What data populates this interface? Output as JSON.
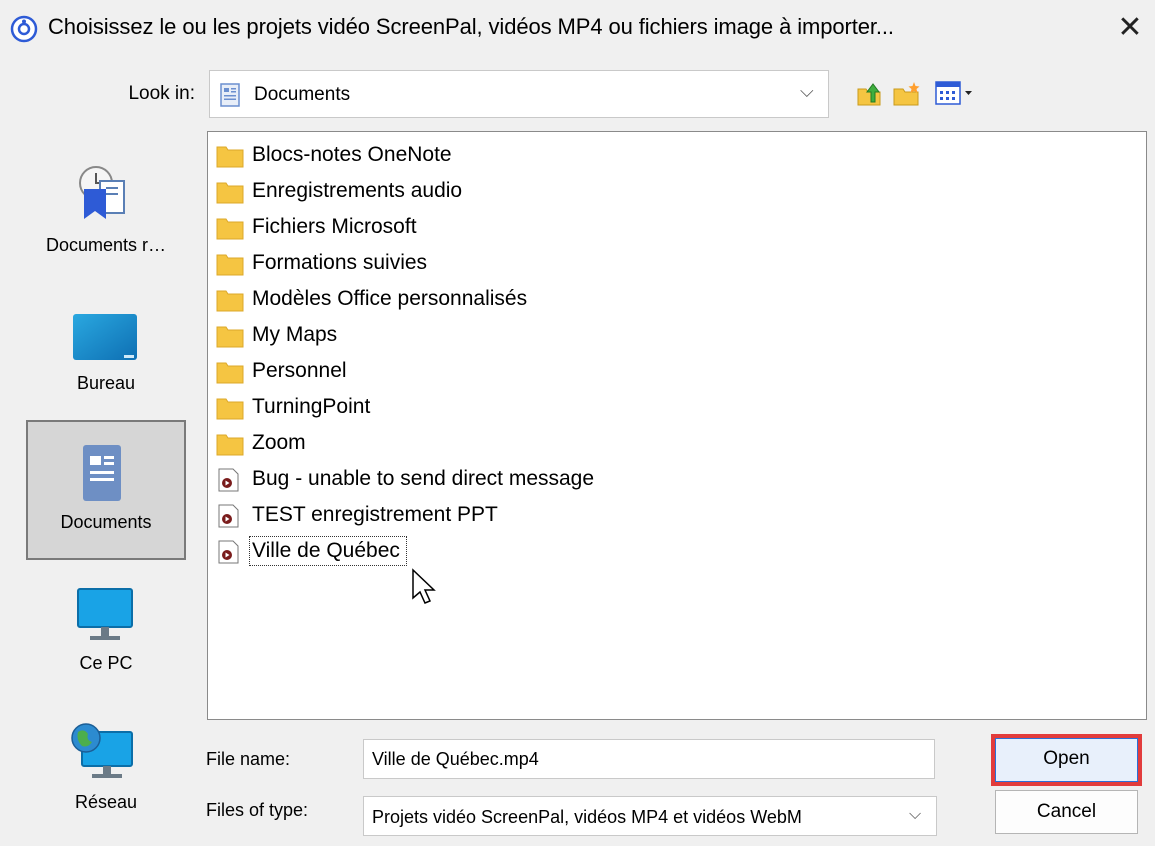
{
  "window": {
    "title": "Choisissez le ou les projets vidéo ScreenPal, vidéos MP4 ou fichiers image à importer...",
    "close_glyph": "✕",
    "app_icon": "screenpal-logo-icon"
  },
  "lookin": {
    "label": "Look in:",
    "value": "Documents",
    "icon": "documents-icon",
    "chevron": "⌵"
  },
  "toolbar": {
    "icons": [
      "up-folder-icon",
      "new-folder-icon",
      "view-menu-icon"
    ]
  },
  "places": [
    {
      "label": "Documents r…",
      "icon": "recent-places-icon",
      "selected": false
    },
    {
      "label": "Bureau",
      "icon": "desktop-icon",
      "selected": false
    },
    {
      "label": "Documents",
      "icon": "documents-icon",
      "selected": true
    },
    {
      "label": "Ce PC",
      "icon": "computer-icon",
      "selected": false
    },
    {
      "label": "Réseau",
      "icon": "network-icon",
      "selected": false
    }
  ],
  "files": [
    {
      "name": "Blocs-notes OneNote",
      "type": "folder"
    },
    {
      "name": "Enregistrements audio",
      "type": "folder"
    },
    {
      "name": "Fichiers Microsoft",
      "type": "folder"
    },
    {
      "name": "Formations suivies",
      "type": "folder"
    },
    {
      "name": "Modèles Office personnalisés",
      "type": "folder"
    },
    {
      "name": "My Maps",
      "type": "folder"
    },
    {
      "name": "Personnel",
      "type": "folder"
    },
    {
      "name": "TurningPoint",
      "type": "folder"
    },
    {
      "name": "Zoom",
      "type": "folder"
    },
    {
      "name": "Bug - unable to send direct message",
      "type": "video"
    },
    {
      "name": "TEST enregistrement PPT",
      "type": "video"
    },
    {
      "name": "Ville de Québec",
      "type": "video",
      "focused": true
    }
  ],
  "filename": {
    "label": "File name:",
    "value": "Ville de Québec.mp4"
  },
  "filetype": {
    "label": "Files of type:",
    "value": "Projets vidéo ScreenPal, vidéos MP4 et vidéos WebM",
    "chevron": "⌵"
  },
  "buttons": {
    "open": "Open",
    "cancel": "Cancel"
  },
  "colors": {
    "highlight": "#e23c3c",
    "folder": "#f5c542",
    "selected_place": "#d6d6d6"
  }
}
